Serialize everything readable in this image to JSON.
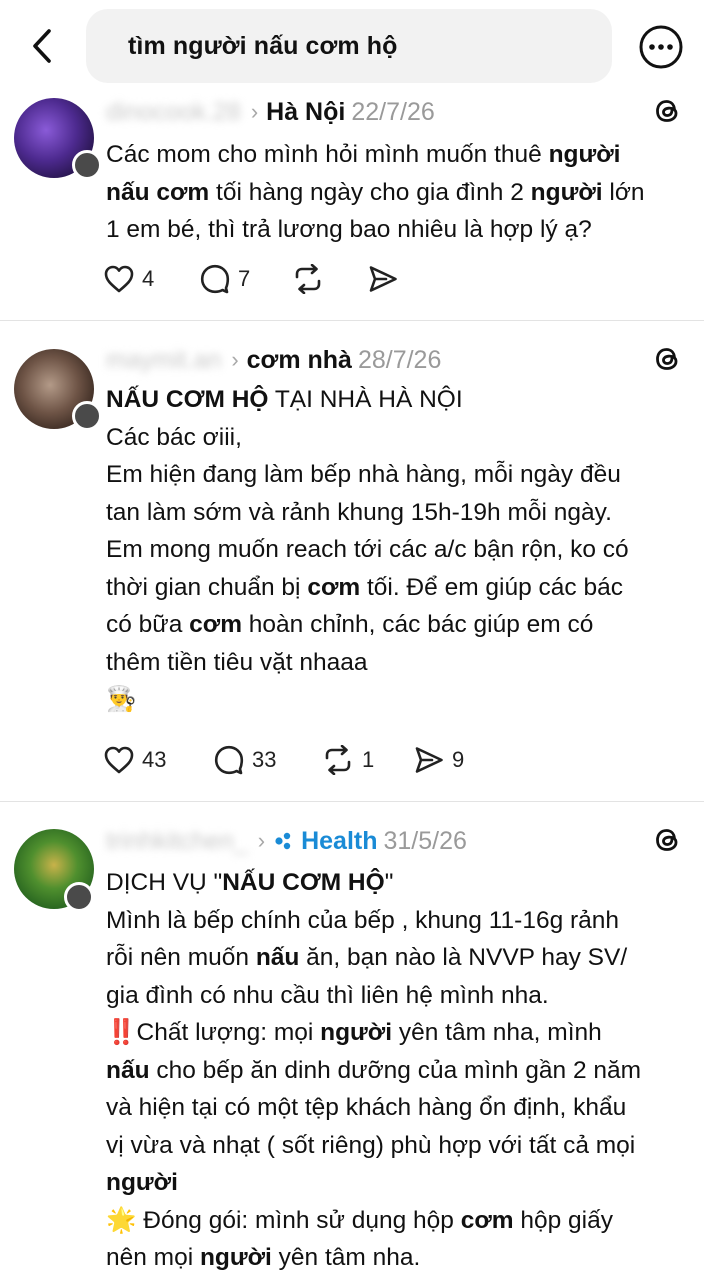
{
  "search": {
    "query": "tìm người nấu cơm hộ"
  },
  "icons": {
    "back": "chevron-left-icon",
    "more": "more-horizontal-icon",
    "threads": "threads-logo-icon",
    "like": "heart-icon",
    "reply": "comment-bubble-icon",
    "repost": "repost-icon",
    "share": "send-icon"
  },
  "colors": {
    "topic_blue": "#1a8bd6",
    "divider": "#e3e3e3",
    "meta_gray": "#9a9a9a"
  },
  "posts": [
    {
      "username": "dinocook.28",
      "topic": "Hà Nội",
      "date": "22/7/26",
      "lines": [
        [
          {
            "t": "Các mom cho mình hỏi mình muốn thuê "
          },
          {
            "t": "người",
            "b": true
          }
        ],
        [
          {
            "t": "nấu cơm",
            "b": true
          },
          {
            "t": " tối hàng ngày cho gia đình 2 "
          },
          {
            "t": "người",
            "b": true
          },
          {
            "t": " lớn"
          }
        ],
        [
          {
            "t": "1 em bé, thì trả lương bao nhiêu là hợp lý ạ?"
          }
        ]
      ],
      "likes": "4",
      "replies": "7",
      "reposts": "",
      "shares": ""
    },
    {
      "username": "maymit.an",
      "topic": "cơm nhà",
      "date": "28/7/26",
      "lines": [
        [
          {
            "t": "NẤU CƠM HỘ",
            "b": true
          },
          {
            "t": " TẠI NHÀ HÀ NỘI"
          }
        ],
        [
          {
            "t": "Các bác ơiii,"
          }
        ],
        [
          {
            "t": "Em hiện đang làm bếp nhà hàng, mỗi ngày đều"
          }
        ],
        [
          {
            "t": "tan làm sớm và rảnh khung 15h-19h mỗi ngày."
          }
        ],
        [
          {
            "t": "Em mong muốn reach tới các a/c bận rộn, ko có"
          }
        ],
        [
          {
            "t": "thời gian chuẩn bị "
          },
          {
            "t": "cơm",
            "b": true
          },
          {
            "t": " tối. Để em giúp các bác"
          }
        ],
        [
          {
            "t": "có bữa "
          },
          {
            "t": "cơm",
            "b": true
          },
          {
            "t": " hoàn chỉnh, các bác giúp em có"
          }
        ],
        [
          {
            "t": "thêm tiền tiêu vặt nhaaa"
          }
        ],
        [
          {
            "t": "👨‍🍳"
          }
        ]
      ],
      "likes": "43",
      "replies": "33",
      "reposts": "1",
      "shares": "9"
    },
    {
      "username": "trinhkitchen_",
      "topic": "Health",
      "date": "31/5/26",
      "lines": [
        [
          {
            "t": "DỊCH VỤ \""
          },
          {
            "t": "NẤU CƠM HỘ",
            "b": true
          },
          {
            "t": "\""
          }
        ],
        [
          {
            "t": "Mình là bếp chính của bếp , khung 11-16g rảnh"
          }
        ],
        [
          {
            "t": "rỗi nên muốn "
          },
          {
            "t": "nấu",
            "b": true
          },
          {
            "t": " ăn, bạn nào là NVVP hay SV/"
          }
        ],
        [
          {
            "t": "gia đình có nhu cầu thì liên hệ mình nha."
          }
        ],
        [
          {
            "t": "‼️Chất lượng: mọi "
          },
          {
            "t": "người",
            "b": true
          },
          {
            "t": " yên tâm nha, mình"
          }
        ],
        [
          {
            "t": "nấu",
            "b": true
          },
          {
            "t": " cho bếp ăn dinh dưỡng của mình gần 2 năm"
          }
        ],
        [
          {
            "t": "và hiện tại có một tệp khách hàng ổn định, khẩu"
          }
        ],
        [
          {
            "t": "vị vừa và nhạt ( sốt riêng) phù hợp với tất cả mọi"
          }
        ],
        [
          {
            "t": "người",
            "b": true
          }
        ],
        [
          {
            "t": "🌟 Đóng gói: mình sử dụng hộp "
          },
          {
            "t": "cơm",
            "b": true
          },
          {
            "t": " hộp giấy"
          }
        ],
        [
          {
            "t": "nên mọi "
          },
          {
            "t": "người",
            "b": true
          },
          {
            "t": " yên tâm nha."
          }
        ]
      ]
    }
  ]
}
